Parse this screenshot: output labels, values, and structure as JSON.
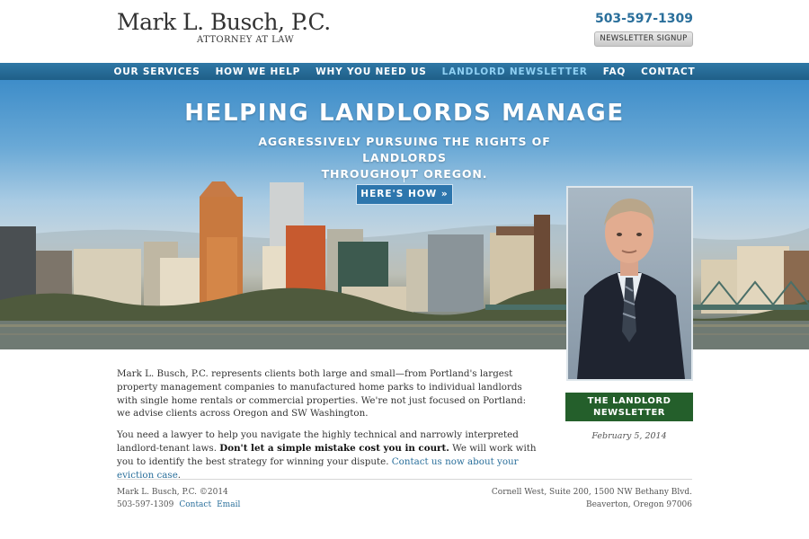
{
  "header": {
    "logo_name": "Mark L. Busch, P.C.",
    "logo_sub": "ATTORNEY AT LAW",
    "phone": "503-597-1309",
    "newsletter_button": "NEWSLETTER SIGNUP"
  },
  "nav": {
    "items": [
      {
        "label": "OUR SERVICES"
      },
      {
        "label": "HOW WE HELP"
      },
      {
        "label": "WHY YOU NEED US"
      },
      {
        "label": "LANDLORD NEWSLETTER"
      },
      {
        "label": "FAQ"
      },
      {
        "label": "CONTACT"
      }
    ],
    "active_index": 3
  },
  "hero": {
    "title": "HELPING LANDLORDS MANAGE",
    "subtitle_line1": "AGGRESSIVELY PURSUING THE RIGHTS OF LANDLORDS",
    "subtitle_line2": "THROUGHOUT OREGON.",
    "cta": "HERE'S HOW »"
  },
  "sidebar": {
    "newsletter_line1": "THE LANDLORD",
    "newsletter_line2": "NEWSLETTER",
    "date": "February 5, 2014"
  },
  "copy": {
    "p1": "Mark L. Busch, P.C. represents clients both large and small—from Portland's largest property management companies to manufactured home parks to individual landlords with single home rentals or commercial properties. We're not just focused on Portland: we advise clients across Oregon and SW Washington.",
    "p2_a": "You need a lawyer to help you navigate the highly technical and narrowly interpreted landlord-tenant laws. ",
    "p2_bold": "Don't let a simple mistake cost you in court.",
    "p2_b": " We will work with you to identify the best strategy for winning your dispute. ",
    "p2_link": "Contact us now about your eviction case",
    "p2_end": "."
  },
  "footer": {
    "copyright": "Mark L. Busch, P.C. ©2014",
    "phone": "503-597-1309",
    "contact_link": "Contact",
    "email_link": "Email",
    "address_line1": "Cornell West, Suite 200, 1500 NW Bethany Blvd.",
    "address_line2": "Beaverton, Oregon 97006"
  },
  "colors": {
    "brand_blue": "#2a6f9b",
    "nav_active": "#8fd0f3",
    "newsletter_green": "#245f2b"
  }
}
